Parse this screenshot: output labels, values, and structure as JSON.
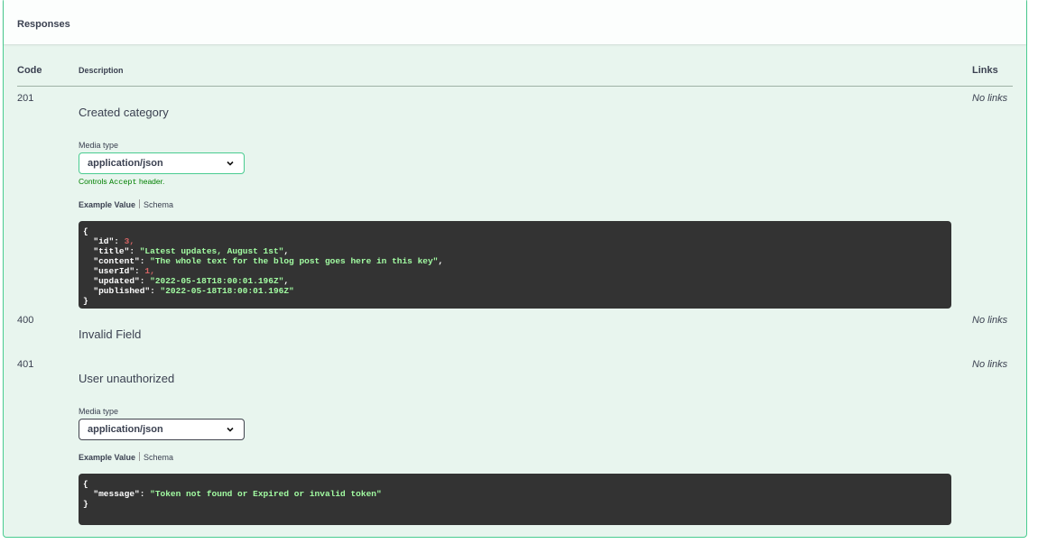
{
  "responses_title": "Responses",
  "table_headers": {
    "code": "Code",
    "description": "Description",
    "links": "Links"
  },
  "responses": [
    {
      "code": "201",
      "description": "Created category",
      "links": "No links",
      "media_type_label": "Media type",
      "media_type": "application/json",
      "controls_text_before": "Controls ",
      "controls_code": "Accept",
      "controls_text_after": " header.",
      "tab_example": "Example Value",
      "tab_schema": "Schema",
      "example": [
        {
          "t": "{"
        },
        {
          "k": "\"id\"",
          "v": "3",
          "vt": "n",
          "c": ","
        },
        {
          "k": "\"title\"",
          "v": "\"Latest updates, August 1st\"",
          "vt": "s",
          "c": ","
        },
        {
          "k": "\"content\"",
          "v": "\"The whole text for the blog post goes here in this key\"",
          "vt": "s",
          "c": ","
        },
        {
          "k": "\"userId\"",
          "v": "1",
          "vt": "n",
          "c": ","
        },
        {
          "k": "\"updated\"",
          "v": "\"2022-05-18T18:00:01.196Z\"",
          "vt": "s",
          "c": ","
        },
        {
          "k": "\"published\"",
          "v": "\"2022-05-18T18:00:01.196Z\"",
          "vt": "s",
          "c": ""
        },
        {
          "t": "}"
        }
      ]
    },
    {
      "code": "400",
      "description": "Invalid Field",
      "links": "No links"
    },
    {
      "code": "401",
      "description": "User unauthorized",
      "links": "No links",
      "media_type_label": "Media type",
      "media_type": "application/json",
      "tab_example": "Example Value",
      "tab_schema": "Schema",
      "example": [
        {
          "t": "{"
        },
        {
          "k": "\"message\"",
          "v": "\"Token not found or Expired or invalid token\"",
          "vt": "s",
          "c": ""
        },
        {
          "t": "}"
        }
      ]
    }
  ]
}
